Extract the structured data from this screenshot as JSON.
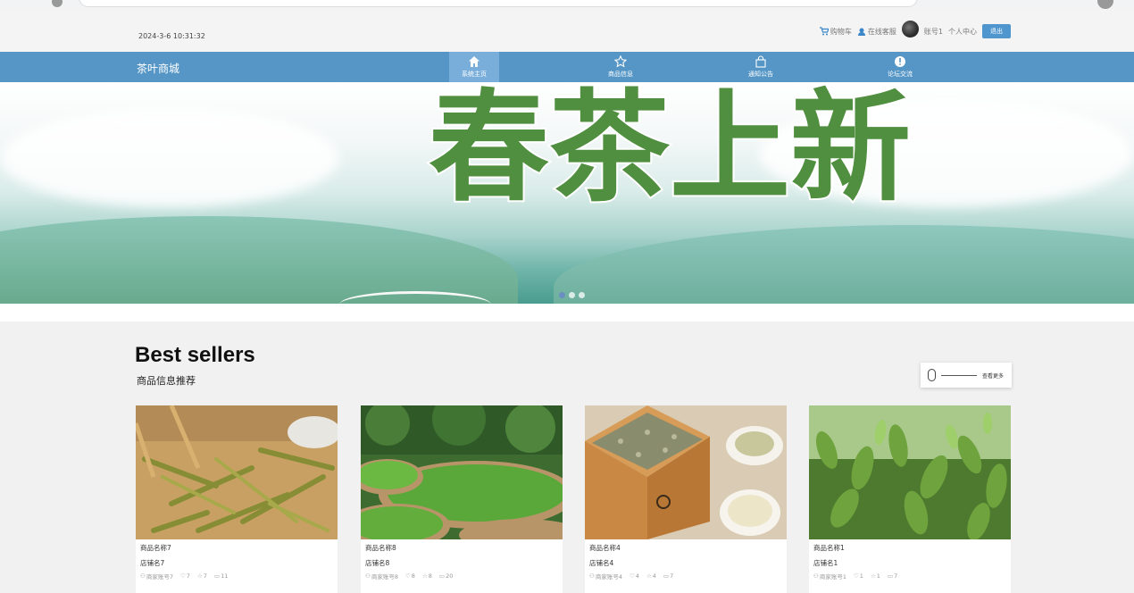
{
  "topbar": {
    "datetime": "2024-3-6 10:31:32",
    "cart": "购物车",
    "service": "在线客服",
    "username": "账号1",
    "profile": "个人中心",
    "logout": "退出"
  },
  "nav": {
    "brand": "茶叶商城",
    "items": [
      {
        "label": "系统主页",
        "icon": "home-icon"
      },
      {
        "label": "商品信息",
        "icon": "star-icon"
      },
      {
        "label": "通知公告",
        "icon": "bag-icon"
      },
      {
        "label": "论坛交流",
        "icon": "alert-icon"
      }
    ]
  },
  "banner": {
    "slogan": "春茶上新",
    "slide_count": 3,
    "active_slide": 1
  },
  "section": {
    "title": "Best sellers",
    "subtitle": "商品信息推荐",
    "more": "查看更多"
  },
  "cards": [
    {
      "name": "商品名称7",
      "shop": "店铺名7",
      "merchant": "商家账号7",
      "likes": "7",
      "favs": "7",
      "comments": "11"
    },
    {
      "name": "商品名称8",
      "shop": "店铺名8",
      "merchant": "商家账号8",
      "likes": "8",
      "favs": "8",
      "comments": "20"
    },
    {
      "name": "商品名称4",
      "shop": "店铺名4",
      "merchant": "商家账号4",
      "likes": "4",
      "favs": "4",
      "comments": "7"
    },
    {
      "name": "商品名称1",
      "shop": "店铺名1",
      "merchant": "商家账号1",
      "likes": "1",
      "favs": "1",
      "comments": "7"
    }
  ],
  "colors": {
    "nav": "#5596c6",
    "nav_active": "#79aedb",
    "logout": "#4f96cf"
  }
}
